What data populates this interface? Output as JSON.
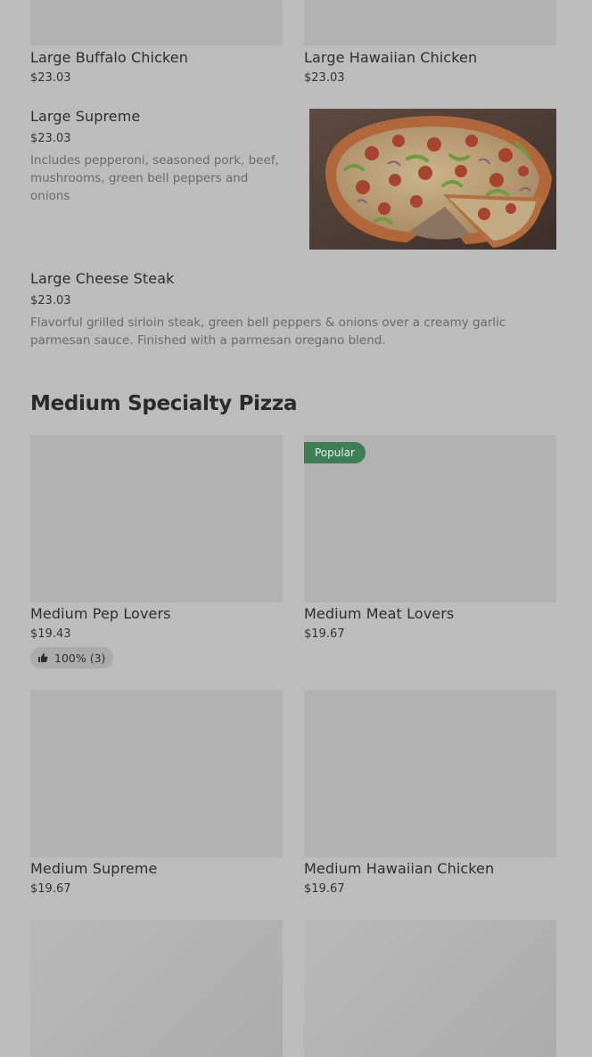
{
  "top_items": [
    {
      "name": "Large Buffalo Chicken",
      "price": "$23.03"
    },
    {
      "name": "Large Hawaiian Chicken",
      "price": "$23.03"
    }
  ],
  "supreme": {
    "name": "Large Supreme",
    "price": "$23.03",
    "description": "Includes pepperoni, seasoned pork, beef, mushrooms, green bell peppers and onions"
  },
  "cheese_steak": {
    "name": "Large Cheese Steak",
    "price": "$23.03",
    "description": "Flavorful grilled sirloin steak, green bell peppers & onions over a creamy garlic parmesan sauce. Finished with a parmesan oregano blend."
  },
  "medium_section": {
    "title": "Medium Specialty Pizza",
    "items": [
      {
        "name": "Medium Pep Lovers",
        "price": "$19.43",
        "rating": "100% (3)"
      },
      {
        "name": "Medium Meat Lovers",
        "price": "$19.67",
        "badge": "Popular"
      },
      {
        "name": "Medium Supreme",
        "price": "$19.67"
      },
      {
        "name": "Medium Hawaiian Chicken",
        "price": "$19.67"
      }
    ]
  },
  "colors": {
    "background": "#bcbcbc",
    "badge": "#3e7e57"
  },
  "icons": [
    "thumbs-up-icon"
  ]
}
